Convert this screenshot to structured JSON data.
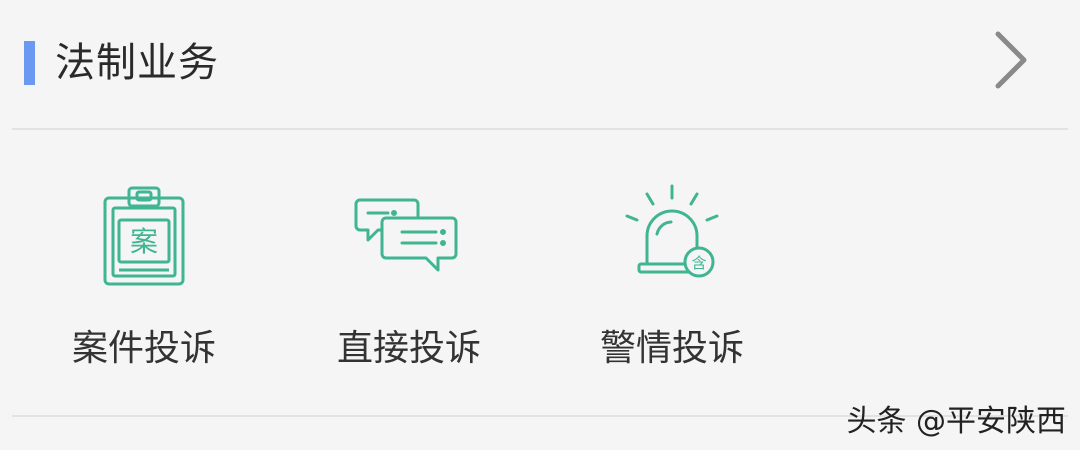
{
  "section": {
    "title": "法制业务",
    "accent_color": "#6b98f0",
    "more_icon": "chevron-right-icon"
  },
  "services": [
    {
      "label": "案件投诉",
      "icon": "case-clipboard-icon",
      "icon_text": "案"
    },
    {
      "label": "直接投诉",
      "icon": "chat-bubbles-icon"
    },
    {
      "label": "警情投诉",
      "icon": "alarm-siren-icon",
      "badge_text": "含"
    }
  ],
  "icon_color": "#3fb592",
  "watermark": "头条 @平安陕西"
}
